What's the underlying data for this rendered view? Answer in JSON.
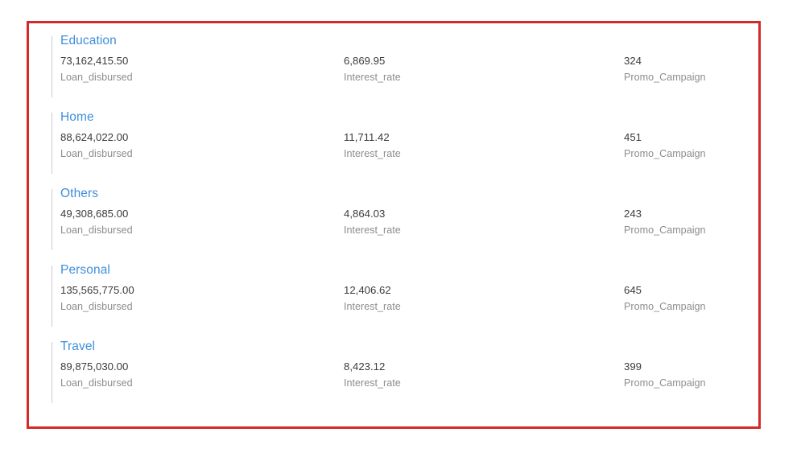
{
  "card": {
    "border_color": "#d32a2a",
    "background": "#ffffff",
    "title_color": "#3f8edc",
    "value_color": "#3b3b3b",
    "label_color": "#8b8d90",
    "rule_color": "#c9ccd0"
  },
  "columns": [
    {
      "field": "Loan_disbursed"
    },
    {
      "field": "Interest_rate"
    },
    {
      "field": "Promo_Campaign"
    }
  ],
  "groups": [
    {
      "title": "Education",
      "metrics": [
        {
          "value": "73,162,415.50",
          "label": "Loan_disbursed"
        },
        {
          "value": "6,869.95",
          "label": "Interest_rate"
        },
        {
          "value": "324",
          "label": "Promo_Campaign"
        }
      ]
    },
    {
      "title": "Home",
      "metrics": [
        {
          "value": "88,624,022.00",
          "label": "Loan_disbursed"
        },
        {
          "value": "11,711.42",
          "label": "Interest_rate"
        },
        {
          "value": "451",
          "label": "Promo_Campaign"
        }
      ]
    },
    {
      "title": "Others",
      "metrics": [
        {
          "value": "49,308,685.00",
          "label": "Loan_disbursed"
        },
        {
          "value": "4,864.03",
          "label": "Interest_rate"
        },
        {
          "value": "243",
          "label": "Promo_Campaign"
        }
      ]
    },
    {
      "title": "Personal",
      "metrics": [
        {
          "value": "135,565,775.00",
          "label": "Loan_disbursed"
        },
        {
          "value": "12,406.62",
          "label": "Interest_rate"
        },
        {
          "value": "645",
          "label": "Promo_Campaign"
        }
      ]
    },
    {
      "title": "Travel",
      "metrics": [
        {
          "value": "89,875,030.00",
          "label": "Loan_disbursed"
        },
        {
          "value": "8,423.12",
          "label": "Interest_rate"
        },
        {
          "value": "399",
          "label": "Promo_Campaign"
        }
      ]
    }
  ],
  "chart_data": {
    "type": "table",
    "title": "",
    "categories": [
      "Education",
      "Home",
      "Others",
      "Personal",
      "Travel"
    ],
    "columns": [
      "Loan_disbursed",
      "Interest_rate",
      "Promo_Campaign"
    ],
    "series": [
      {
        "name": "Loan_disbursed",
        "values": [
          73162415.5,
          88624022.0,
          49308685.0,
          135565775.0,
          89875030.0
        ],
        "display": [
          "73,162,415.50",
          "88,624,022.00",
          "49,308,685.00",
          "135,565,775.00",
          "89,875,030.00"
        ]
      },
      {
        "name": "Interest_rate",
        "values": [
          6869.95,
          11711.42,
          4864.03,
          12406.62,
          8423.12
        ],
        "display": [
          "6,869.95",
          "11,711.42",
          "4,864.03",
          "12,406.62",
          "8,423.12"
        ]
      },
      {
        "name": "Promo_Campaign",
        "values": [
          324,
          451,
          243,
          645,
          399
        ],
        "display": [
          "324",
          "451",
          "243",
          "645",
          "399"
        ]
      }
    ],
    "xlabel": "",
    "ylabel": "",
    "grid": false,
    "legend": "none"
  }
}
